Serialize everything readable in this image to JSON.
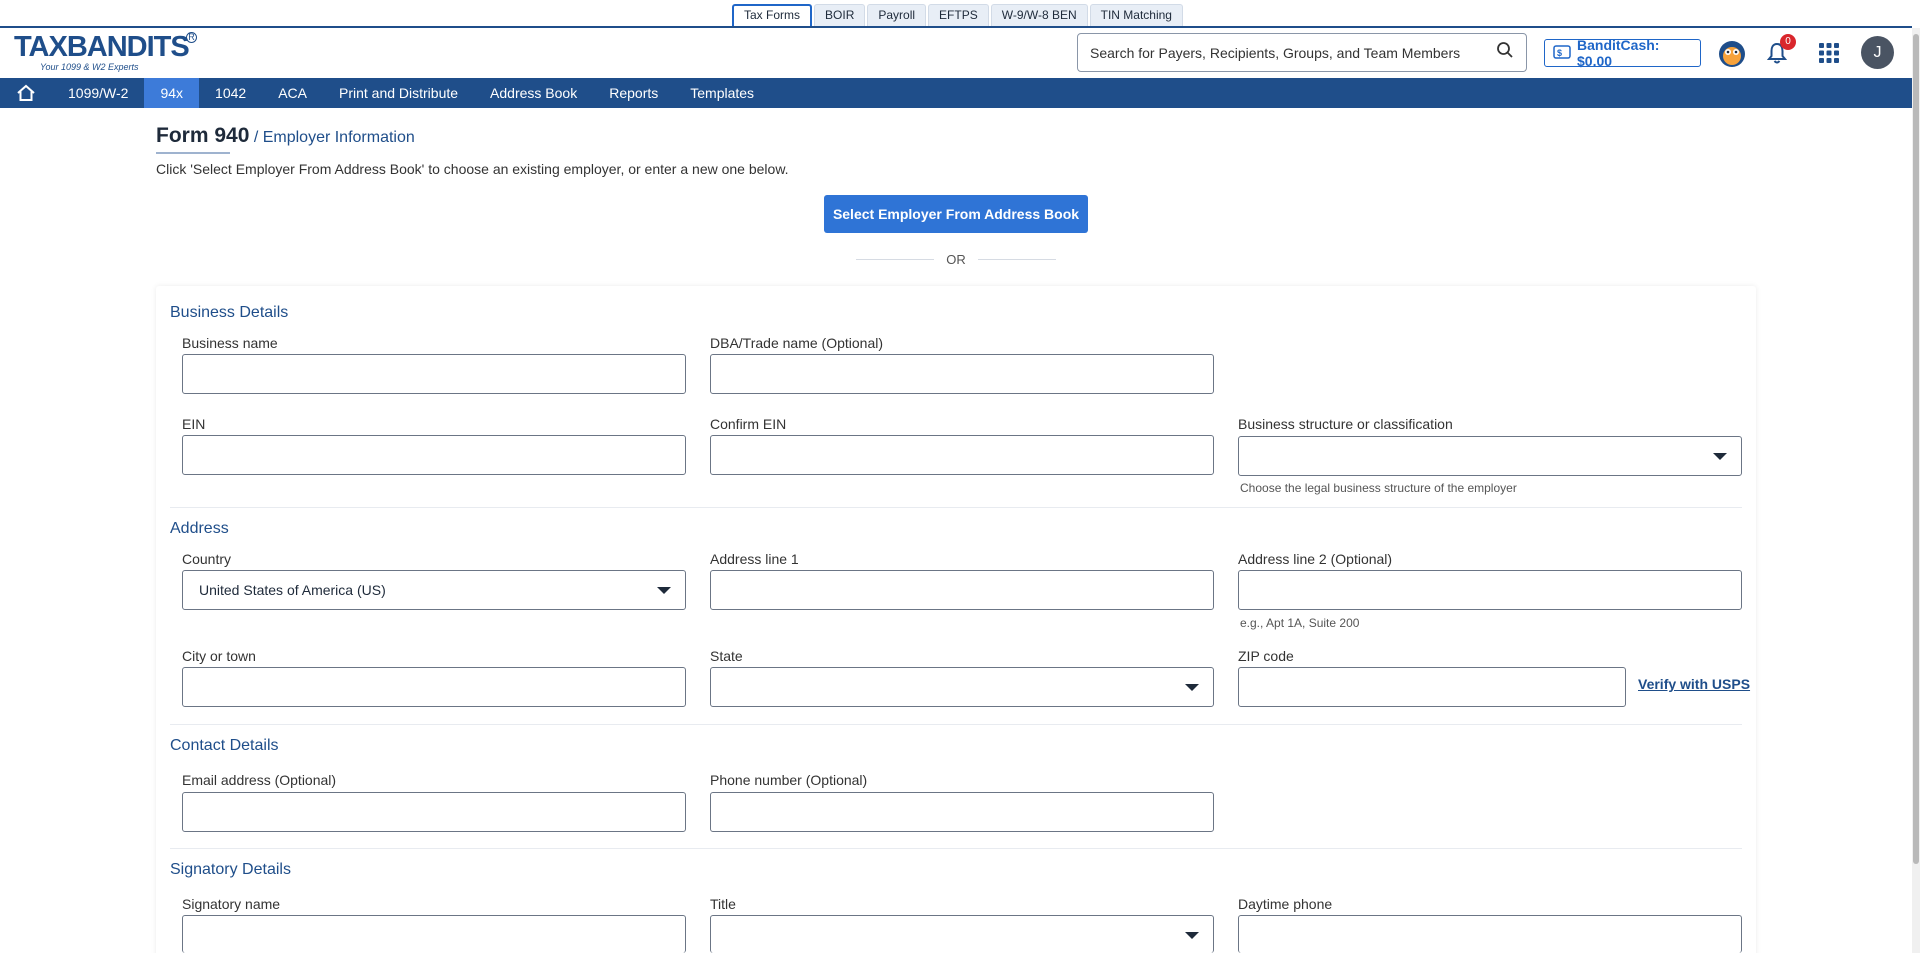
{
  "product_tabs": [
    "Tax Forms",
    "BOIR",
    "Payroll",
    "EFTPS",
    "W-9/W-8 BEN",
    "TIN Matching"
  ],
  "logo": {
    "main": "TAXBANDITS",
    "tagline": "Your 1099 & W2 Experts",
    "reg": "R"
  },
  "search": {
    "placeholder": "Search for Payers, Recipients, Groups, and Team Members"
  },
  "bandit_cash": "BanditCash: $0.00",
  "notifications": {
    "count": "0"
  },
  "user": {
    "initial": "J"
  },
  "nav": [
    "1099/W-2",
    "94x",
    "1042",
    "ACA",
    "Print and Distribute",
    "Address Book",
    "Reports",
    "Templates"
  ],
  "page": {
    "title": "Form 940",
    "subtitle": " / Employer Information",
    "instruction": "Click 'Select Employer From Address Book' to choose an existing employer, or enter a new one below.",
    "select_button": "Select Employer From Address Book",
    "or": "OR"
  },
  "business": {
    "title": "Business Details",
    "business_name": "Business name",
    "dba": "DBA/Trade name (Optional)",
    "ein": "EIN",
    "confirm_ein": "Confirm EIN",
    "structure": "Business structure or classification",
    "structure_help": "Choose the legal business structure of the employer"
  },
  "address": {
    "title": "Address",
    "country": "Country",
    "country_value": "United States of America (US)",
    "line1": "Address line 1",
    "line2": "Address line 2 (Optional)",
    "line2_help": "e.g., Apt 1A, Suite 200",
    "city": "City or town",
    "state": "State",
    "zip": "ZIP code",
    "verify": "Verify with USPS"
  },
  "contact": {
    "title": "Contact Details",
    "email": "Email address (Optional)",
    "phone": "Phone number (Optional)"
  },
  "signatory": {
    "title": "Signatory Details",
    "name": "Signatory name",
    "title_label": "Title",
    "daytime_phone": "Daytime phone"
  },
  "colors": {
    "brand": "#1f4e8a",
    "accent": "#2f74d6",
    "alert": "#d9262c"
  }
}
